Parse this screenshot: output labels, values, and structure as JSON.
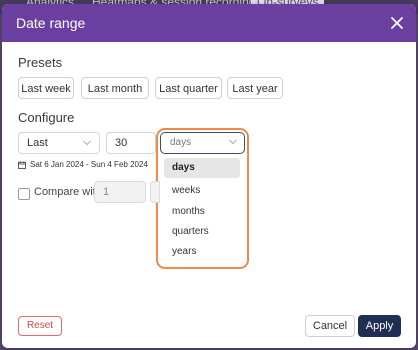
{
  "background_tabs": [
    {
      "label": "Analytics"
    },
    {
      "label": "Heatmaps & session recordings"
    },
    {
      "label": "On-surveys"
    }
  ],
  "dialog": {
    "title": "Date range",
    "close_icon": "close-icon"
  },
  "presets": {
    "title": "Presets",
    "buttons": [
      "Last week",
      "Last month",
      "Last quarter",
      "Last year"
    ]
  },
  "configure": {
    "title": "Configure",
    "mode_select": {
      "value": "Last",
      "options_icon": "chevron-down-icon"
    },
    "amount_input": {
      "value": "30"
    },
    "unit_select": {
      "value": "days",
      "options": [
        "days",
        "weeks",
        "months",
        "quarters",
        "years"
      ],
      "selected": "days"
    },
    "date_range_text": "Sat 6 Jan 2024 - Sun 4 Feb 2024",
    "calendar_icon": "calendar-icon"
  },
  "compare": {
    "label": "Compare with",
    "value": "1",
    "checked": false
  },
  "footer": {
    "reset_label": "Reset",
    "cancel_label": "Cancel",
    "apply_label": "Apply"
  },
  "colors": {
    "header": "#6b3fa0",
    "apply": "#1f2e52",
    "reset": "#d04a4a",
    "highlight": "#f08a4b"
  }
}
